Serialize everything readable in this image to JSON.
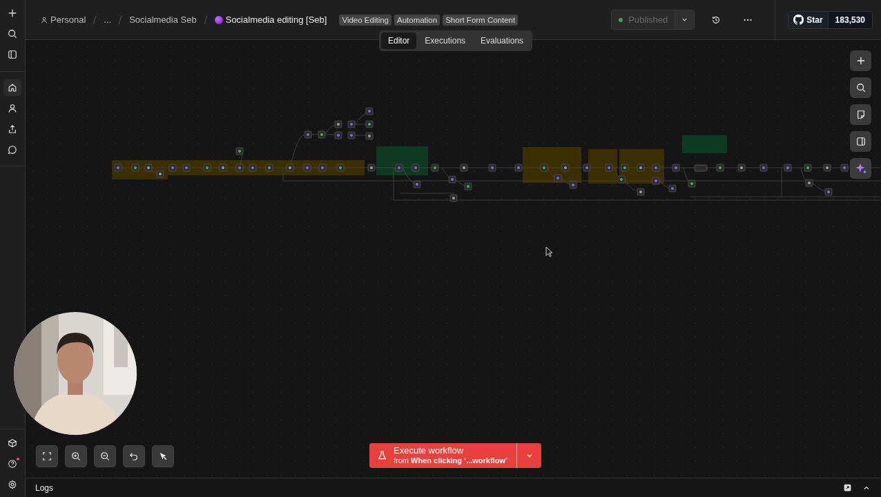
{
  "breadcrumb": {
    "owner": "Personal",
    "ellipsis": "...",
    "folder": "Socialmedia Seb",
    "workflow": "Socialmedia editing [Seb]"
  },
  "tags": [
    "Video Editing",
    "Automation",
    "Short Form Content"
  ],
  "view_tabs": [
    {
      "label": "Editor",
      "selected": true
    },
    {
      "label": "Executions",
      "selected": false
    },
    {
      "label": "Evaluations",
      "selected": false
    }
  ],
  "publish": {
    "label": "Published",
    "active": true
  },
  "github": {
    "label": "Star",
    "count": "183,530"
  },
  "sidebar": {
    "nav": [
      {
        "selected": true
      },
      {
        "selected": false
      },
      {
        "selected": false
      },
      {
        "selected": false
      }
    ],
    "help": {
      "notification": true
    }
  },
  "execute": {
    "title": "Execute workflow",
    "subtitle": "from **When clicking ‘...workflow’**"
  },
  "logs": {
    "label": "Logs"
  }
}
